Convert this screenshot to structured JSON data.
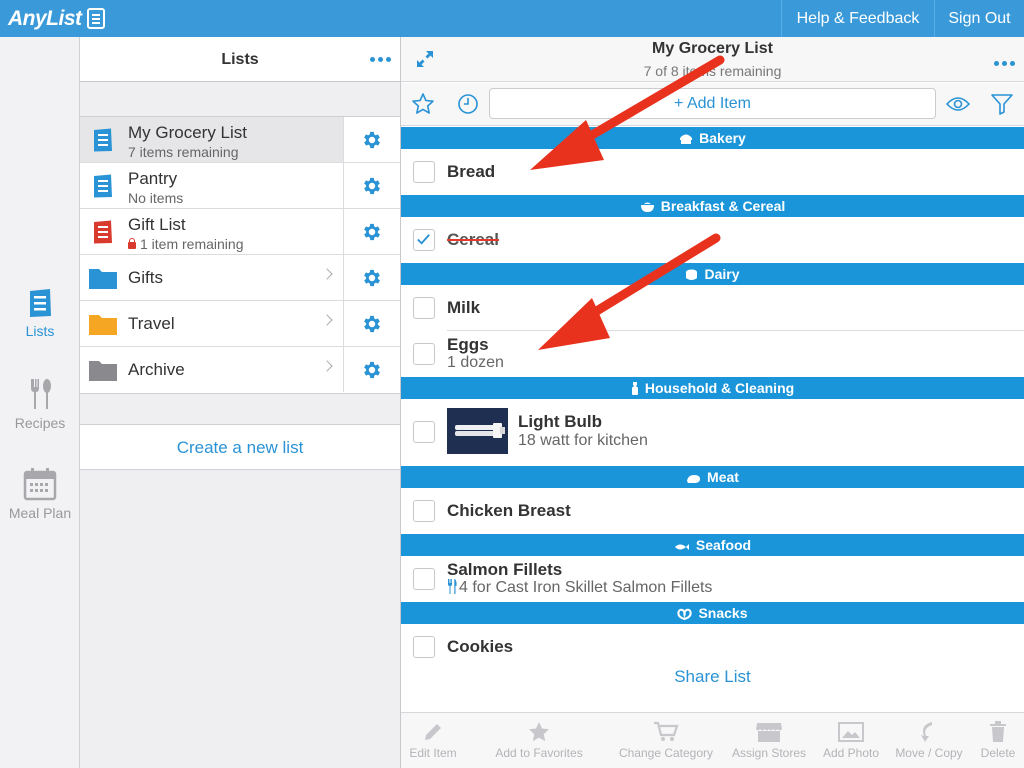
{
  "app": {
    "logo_text": "AnyList",
    "help_label": "Help & Feedback",
    "signout_label": "Sign Out"
  },
  "nav": {
    "items": [
      {
        "label": "Lists",
        "icon": "list-icon",
        "active": true
      },
      {
        "label": "Recipes",
        "icon": "fork-spoon-icon",
        "active": false
      },
      {
        "label": "Meal Plan",
        "icon": "calendar-icon",
        "active": false
      }
    ]
  },
  "lists_panel": {
    "title": "Lists",
    "rows": [
      {
        "name": "My Grocery List",
        "subtitle": "7 items remaining",
        "icon": "list-icon",
        "color": "#2a93d5",
        "selected": true
      },
      {
        "name": "Pantry",
        "subtitle": "No items",
        "icon": "list-icon",
        "color": "#2a93d5"
      },
      {
        "name": "Gift List",
        "subtitle": "1 item remaining",
        "icon": "list-icon",
        "color": "#d93a2e",
        "locked": true
      },
      {
        "name": "Gifts",
        "icon": "folder-icon",
        "color": "#2a93d5"
      },
      {
        "name": "Travel",
        "icon": "folder-icon",
        "color": "#f5a623"
      },
      {
        "name": "Archive",
        "icon": "folder-icon",
        "color": "#8a8a8e"
      }
    ],
    "create_label": "Create a new list"
  },
  "main": {
    "title": "My Grocery List",
    "subtitle": "7 of 8 items remaining",
    "add_item_label": "+ Add Item",
    "categories": [
      {
        "name": "Bakery",
        "icon": "bread-icon",
        "items": [
          {
            "name": "Bread",
            "checked": false
          }
        ]
      },
      {
        "name": "Breakfast & Cereal",
        "icon": "bowl-icon",
        "items": [
          {
            "name": "Cereal",
            "checked": true
          }
        ]
      },
      {
        "name": "Dairy",
        "icon": "cheese-icon",
        "items": [
          {
            "name": "Milk",
            "checked": false
          },
          {
            "name": "Eggs",
            "note": "1 dozen",
            "checked": false
          }
        ]
      },
      {
        "name": "Household & Cleaning",
        "icon": "spray-bottle-icon",
        "items": [
          {
            "name": "Light Bulb",
            "note": "18 watt for kitchen",
            "checked": false,
            "has_photo": true
          }
        ]
      },
      {
        "name": "Meat",
        "icon": "meat-icon",
        "items": [
          {
            "name": "Chicken Breast",
            "checked": false
          }
        ]
      },
      {
        "name": "Seafood",
        "icon": "fish-icon",
        "items": [
          {
            "name": "Salmon Fillets",
            "note": "4 for Cast Iron Skillet Salmon Fillets",
            "checked": false,
            "recipe_link": true
          }
        ]
      },
      {
        "name": "Snacks",
        "icon": "pretzel-icon",
        "items": [
          {
            "name": "Cookies",
            "checked": false
          }
        ]
      }
    ],
    "share_label": "Share List",
    "actions": [
      {
        "label": "Edit Item",
        "icon": "pencil-icon"
      },
      {
        "label": "Add to Favorites",
        "icon": "star-icon"
      },
      {
        "label": "Change Category",
        "icon": "cart-icon"
      },
      {
        "label": "Assign Stores",
        "icon": "store-icon"
      },
      {
        "label": "Add Photo",
        "icon": "photo-icon"
      },
      {
        "label": "Move / Copy",
        "icon": "move-icon"
      },
      {
        "label": "Delete",
        "icon": "trash-icon"
      }
    ]
  },
  "colors": {
    "brand_blue": "#3a9ad9",
    "category_blue": "#1a95d9",
    "accent": "#2a93d5",
    "annotation_arrow": "#e8321e"
  }
}
